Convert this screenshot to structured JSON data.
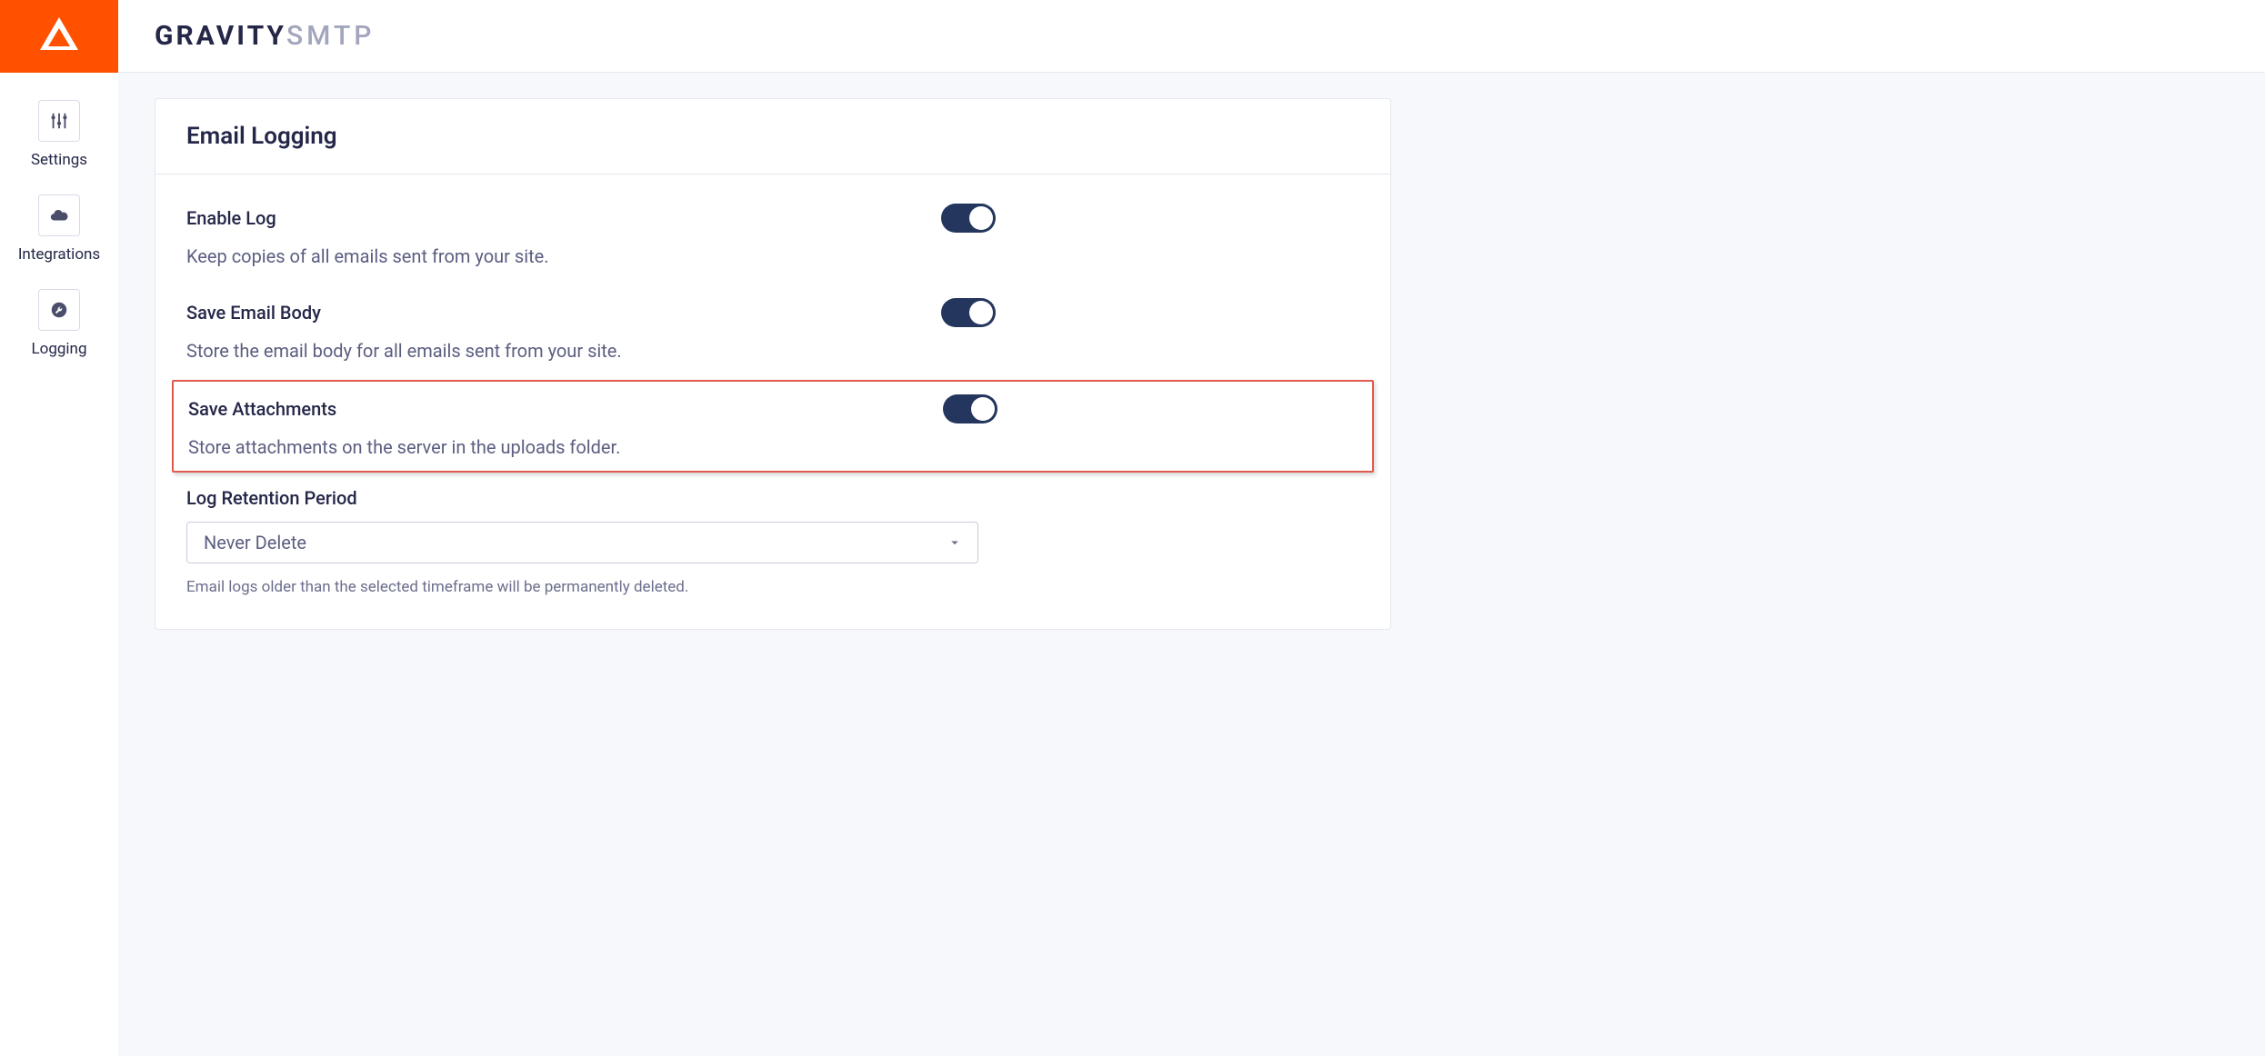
{
  "brand": {
    "name_strong": "GRAVITY",
    "name_light": "SMTP"
  },
  "sidebar": {
    "items": [
      {
        "label": "Settings",
        "icon": "sliders-icon"
      },
      {
        "label": "Integrations",
        "icon": "cloud-icon"
      },
      {
        "label": "Logging",
        "icon": "wrench-circle-icon"
      }
    ]
  },
  "card": {
    "title": "Email Logging",
    "settings": [
      {
        "label": "Enable Log",
        "description": "Keep copies of all emails sent from your site.",
        "enabled": true
      },
      {
        "label": "Save Email Body",
        "description": "Store the email body for all emails sent from your site.",
        "enabled": true
      },
      {
        "label": "Save Attachments",
        "description": "Store attachments on the server in the uploads folder.",
        "enabled": true,
        "highlighted": true
      }
    ],
    "retention": {
      "label": "Log Retention Period",
      "selected": "Never Delete",
      "help": "Email logs older than the selected timeframe will be permanently deleted."
    }
  }
}
